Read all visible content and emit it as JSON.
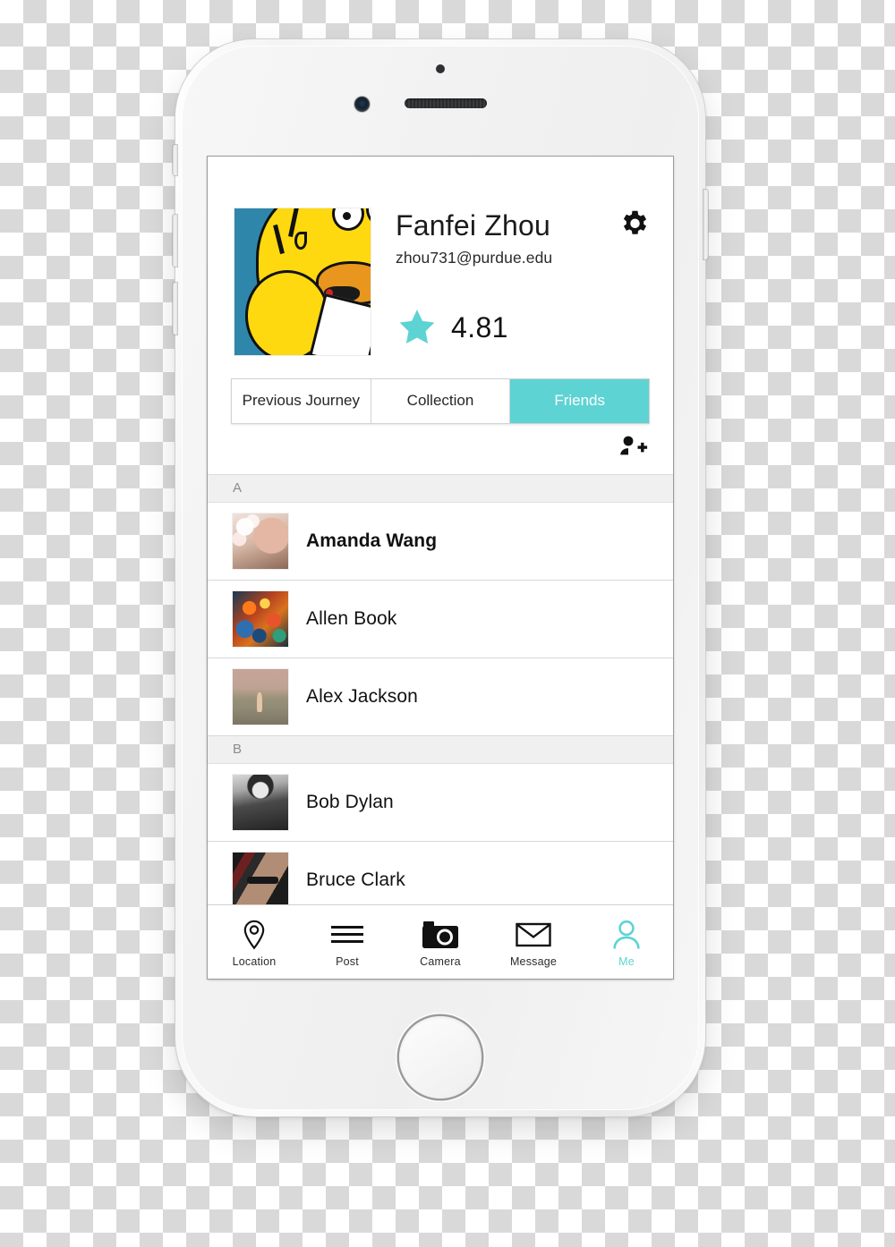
{
  "theme": {
    "accent": "#5ED3D3",
    "text": "#111111",
    "section_header_bg": "#F0F0F0",
    "screen_bg": "#FFFFFF"
  },
  "profile": {
    "name": "Fanfei Zhou",
    "email": "zhou731@purdue.edu",
    "rating": "4.81",
    "avatar_icon": "homer-simpson-avatar",
    "settings_icon": "gear-icon",
    "star_icon": "star-icon"
  },
  "tabs": [
    {
      "label": "Previous Journey",
      "active": false
    },
    {
      "label": "Collection",
      "active": false
    },
    {
      "label": "Friends",
      "active": true
    }
  ],
  "action_bar": {
    "add_friend_icon": "add-person-icon"
  },
  "friends": {
    "sections": [
      {
        "letter": "A",
        "people": [
          {
            "name": "Amanda Wang",
            "bold": true,
            "avatar_icon": "photo-portrait-blossom"
          },
          {
            "name": "Allen Book",
            "bold": false,
            "avatar_icon": "photo-abstract-colorful"
          },
          {
            "name": "Alex Jackson",
            "bold": false,
            "avatar_icon": "photo-beach-figure"
          }
        ]
      },
      {
        "letter": "B",
        "people": [
          {
            "name": "Bob Dylan",
            "bold": false,
            "avatar_icon": "photo-portrait-bw"
          },
          {
            "name": "Bruce Clark",
            "bold": false,
            "avatar_icon": "photo-portrait-glasses"
          }
        ]
      }
    ]
  },
  "bottom_nav": [
    {
      "label": "Location",
      "icon": "location-pin-icon",
      "active": false
    },
    {
      "label": "Post",
      "icon": "hamburger-lines-icon",
      "active": false
    },
    {
      "label": "Camera",
      "icon": "camera-icon",
      "active": false
    },
    {
      "label": "Message",
      "icon": "envelope-icon",
      "active": false
    },
    {
      "label": "Me",
      "icon": "person-icon",
      "active": true
    }
  ]
}
